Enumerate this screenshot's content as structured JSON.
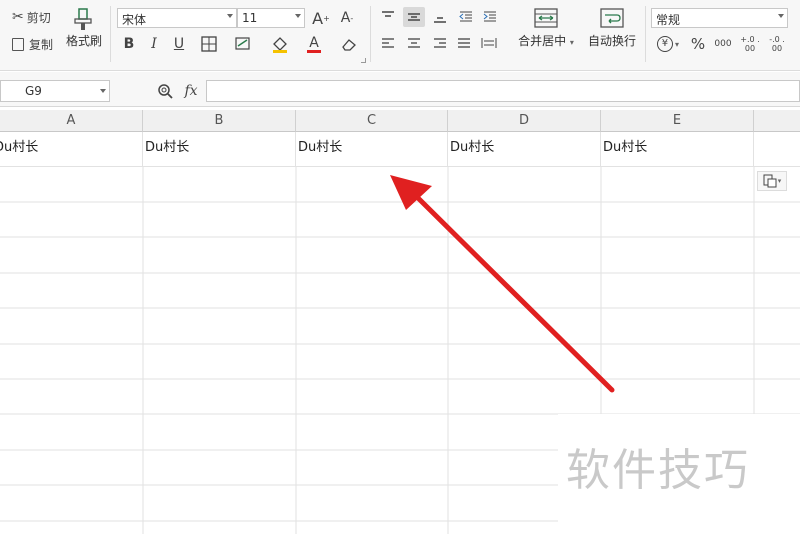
{
  "ribbon": {
    "clipboard": {
      "cut": "剪切",
      "copy": "复制",
      "format_painter": "格式刷"
    },
    "font": {
      "name": "宋体",
      "size": "11",
      "bold": "B",
      "italic": "I",
      "underline": "U",
      "font_color_glyph": "A"
    },
    "alignment": {
      "merge_center": "合并居中",
      "wrap_text": "自动换行"
    },
    "number": {
      "format": "常规",
      "currency": "¥",
      "percent": "%",
      "thousands": "000",
      "inc_decimal": "+.0 .00",
      "dec_decimal": "-.0 .00"
    },
    "font_grow": "A",
    "font_shrink": "A"
  },
  "formula_bar": {
    "cell_ref": "G9",
    "fx": "fx",
    "formula": ""
  },
  "sheet": {
    "columns": [
      "A",
      "B",
      "C",
      "D",
      "E"
    ],
    "row1": [
      "Du村长",
      "Du村长",
      "Du村长",
      "Du村长",
      "Du村长"
    ]
  },
  "watermark": "软件技巧",
  "colors": {
    "arrow": "#e02020",
    "header_bg": "#f0f0f0",
    "ribbon_bg": "#f7f7f7"
  }
}
